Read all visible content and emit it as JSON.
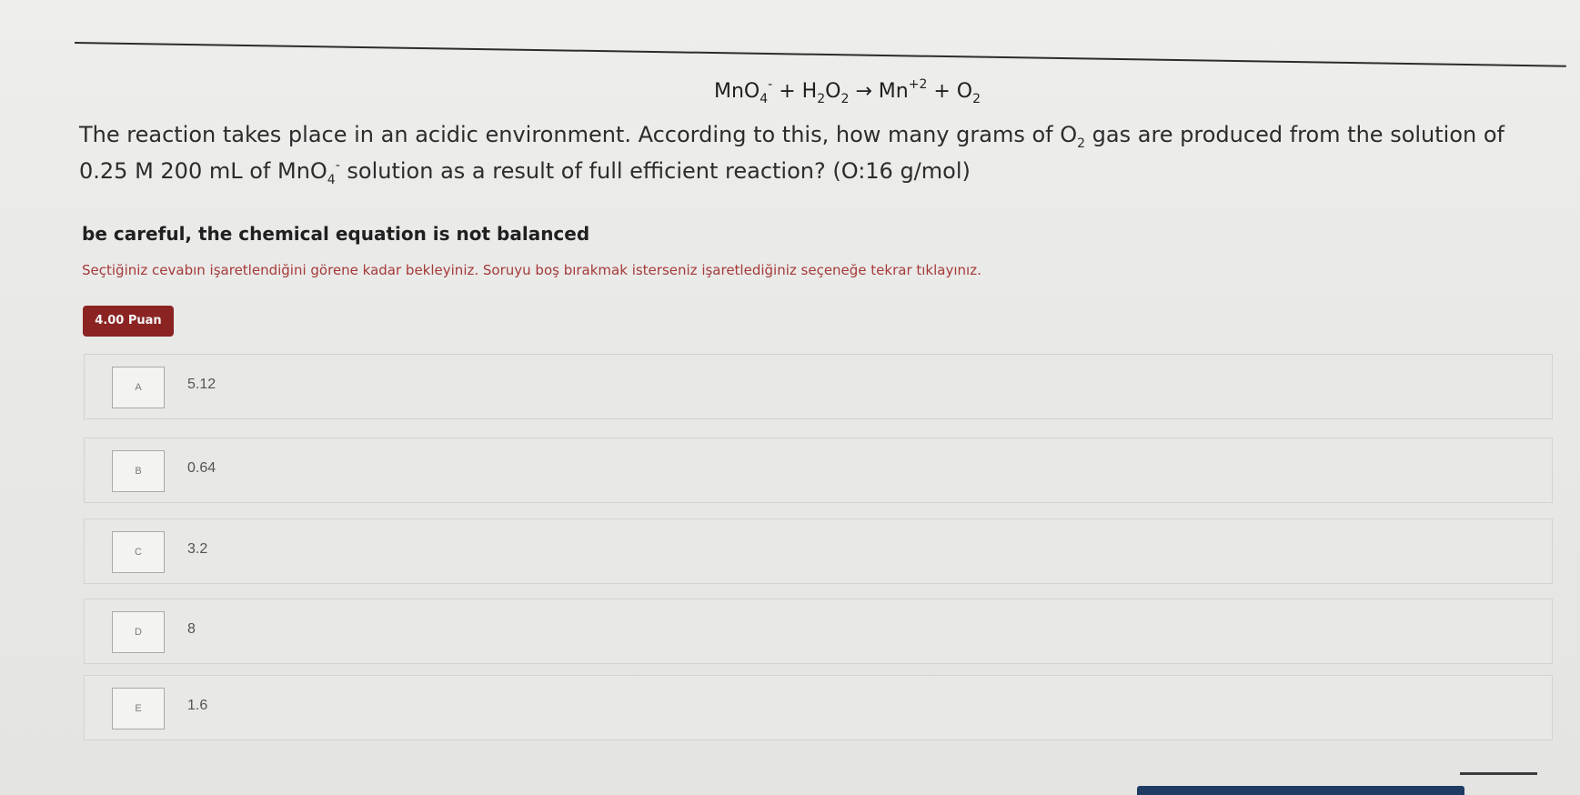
{
  "equation": {
    "mno4": "MnO",
    "sub4": "4",
    "minus": "-",
    "plus1": " + ",
    "h2o2a": "H",
    "sub2a": "2",
    "h2o2b": "O",
    "sub2b": "2",
    "arrow": " → ",
    "mn": "Mn",
    "sup2": "+2",
    "plus2": " + ",
    "o2": "O",
    "subo2": "2"
  },
  "question": {
    "part1": "The reaction takes place in an acidic environment. According to this, how many grams of ",
    "o": "O",
    "o_sub": "2",
    "part2": " gas are produced from the solution of 0.25 M 200 mL of ",
    "mno4": "MnO",
    "mno4_sub": "4",
    "mno4_sup": "-",
    "part3": " solution as a result of full efficient reaction? (O:16 g/mol)"
  },
  "careful_text": "be careful, the chemical equation is not balanced",
  "instruction_text": "Seçtiğiniz cevabın işaretlendiğini görene kadar bekleyiniz. Soruyu boş bırakmak isterseniz işaretlediğiniz seçeneğe tekrar tıklayınız.",
  "points_badge": "4.00 Puan",
  "options": [
    {
      "letter": "A",
      "value": "5.12"
    },
    {
      "letter": "B",
      "value": "0.64"
    },
    {
      "letter": "C",
      "value": "3.2"
    },
    {
      "letter": "D",
      "value": "8"
    },
    {
      "letter": "E",
      "value": "1.6"
    }
  ]
}
